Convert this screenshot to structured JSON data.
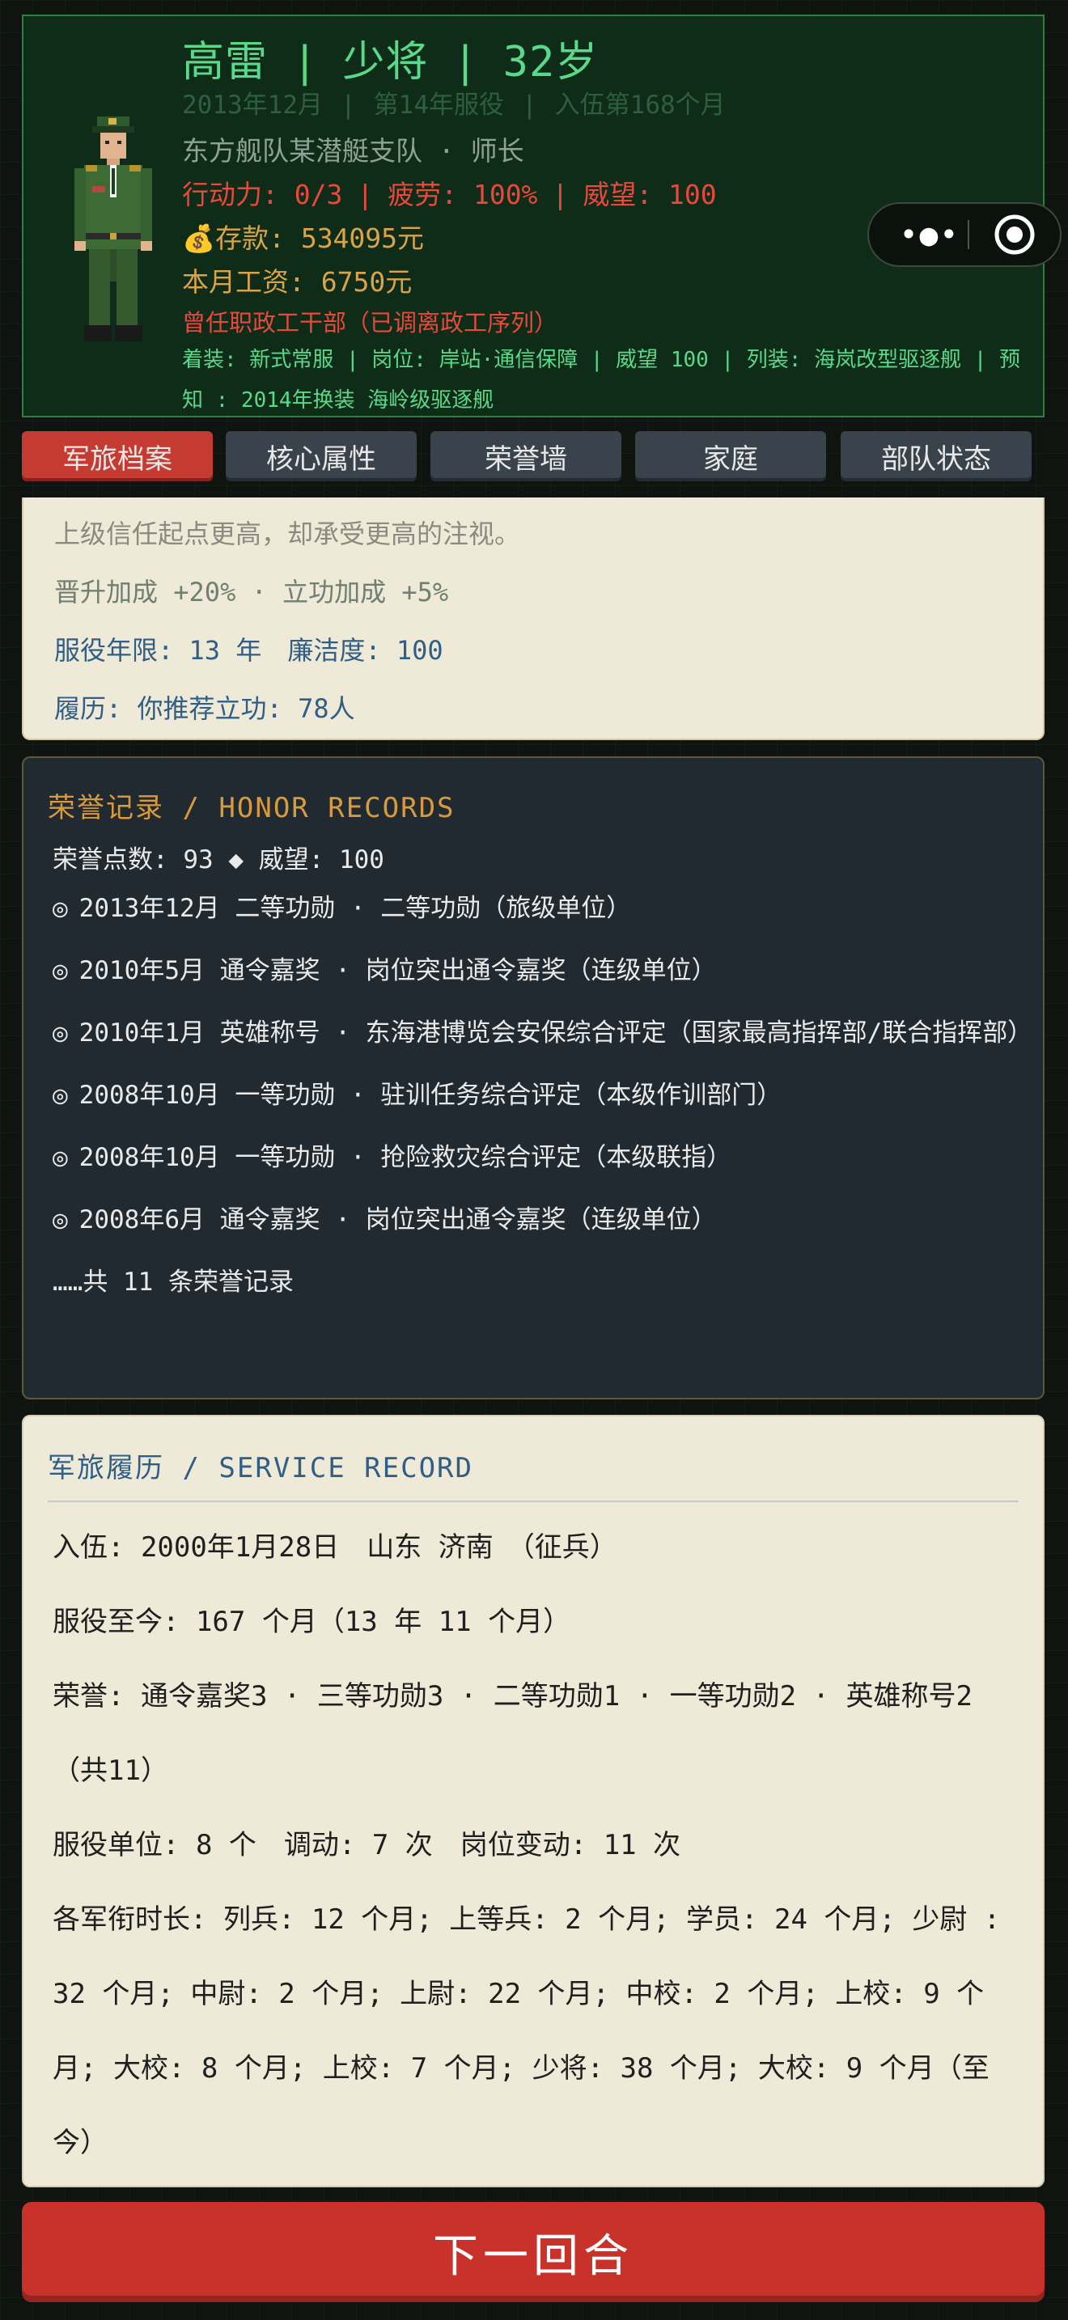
{
  "profile": {
    "name": "高雷",
    "rank": "少将",
    "age": "32岁",
    "date": "2013年12月",
    "service_year": "第14年服役",
    "months": "入伍第168个月",
    "unit_line": "东方舰队某潜艇支队 · 师长",
    "action_label": "行动力: 0/3",
    "fatigue_label": "疲劳: 100%",
    "prestige_label": "威望: 100",
    "savings_label": "💰存款: 534095元",
    "salary_label": "本月工资: 6750元",
    "former_label": "曾任职政工干部（已调离政工序列）",
    "outfit_label": "着装: 新式常服 | 岗位: 岸站·通信保障 | 威望 100 | 列装: 海岚改型驱逐舰 | 预知 : 2014年换装 海岭级驱逐舰"
  },
  "capsule": {
    "more_icon": "more-dots-icon",
    "close_icon": "target-circle-icon"
  },
  "tabs": [
    {
      "label": "军旅档案",
      "active": true
    },
    {
      "label": "核心属性",
      "active": false
    },
    {
      "label": "荣誉墙",
      "active": false
    },
    {
      "label": "家庭",
      "active": false
    },
    {
      "label": "部队状态",
      "active": false
    }
  ],
  "top_card": {
    "trust_text": "上级信任起点更高，却承受更高的注视。",
    "bonus_text": "晋升加成 +20% · 立功加成 +5%",
    "years_text": "服役年限: 13 年　廉洁度: 100",
    "resume_text": "履历: 你推荐立功: 78人"
  },
  "honor": {
    "title": "荣誉记录 / HONOR RECORDS",
    "summary": "荣誉点数: 93 ◆ 威望: 100",
    "items": [
      "2013年12月 二等功勋 · 二等功勋（旅级单位）",
      "2010年5月 通令嘉奖 · 岗位突出通令嘉奖（连级单位）",
      "2010年1月 英雄称号 · 东海港博览会安保综合评定（国家最高指挥部/联合指挥部）",
      "2008年10月 一等功勋 · 驻训任务综合评定（本级作训部门）",
      "2008年10月 一等功勋 · 抢险救灾综合评定（本级联指）",
      "2008年6月 通令嘉奖 · 岗位突出通令嘉奖（连级单位）"
    ],
    "bullet": "◎",
    "more": "……共 11 条荣誉记录"
  },
  "service": {
    "title": "军旅履历 / SERVICE RECORD",
    "enlist": "入伍: 2000年1月28日　山东 济南　（征兵）",
    "duration": "服役至今: 167 个月（13 年 11 个月）",
    "honors": "荣誉: 通令嘉奖3 · 三等功勋3 · 二等功勋1 · 一等功勋2 · 英雄称号2（共11）",
    "units": "服役单位: 8 个　调动: 7 次　岗位变动: 11 次",
    "ranks": "各军衔时长: 列兵: 12 个月; 上等兵: 2 个月; 学员: 24 个月; 少尉 : 32 个月; 中尉: 2 个月; 上尉: 22 个月; 中校: 2 个月; 上校: 9 个月; 大校: 8 个月; 上校: 7 个月; 少将: 38 个月; 大校: 9 个月（至今）"
  },
  "next_button": "下一回合",
  "colors": {
    "header_bg": "#0f2c18",
    "name_green": "#59d989",
    "alert_red": "#e8493c",
    "gold": "#d9a448",
    "tab_active": "#c53a31",
    "tab_inactive": "#3a434b",
    "next_red": "#c8322a"
  }
}
